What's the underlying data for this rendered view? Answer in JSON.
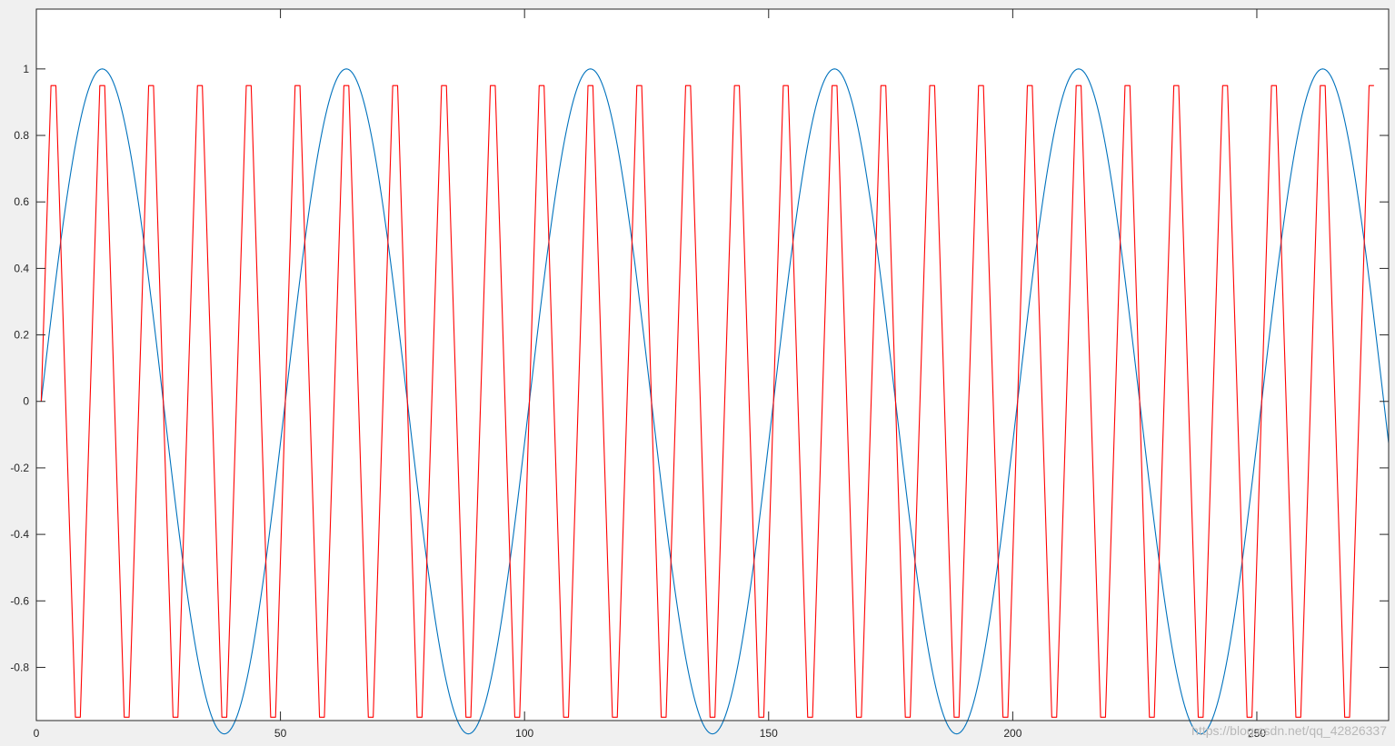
{
  "chart_data": {
    "type": "line",
    "title": "",
    "xlabel": "",
    "ylabel": "",
    "xlim": [
      0,
      277
    ],
    "ylim": [
      -0.96,
      1.18
    ],
    "xticks": [
      0,
      50,
      100,
      150,
      200,
      250
    ],
    "xtick_labels": [
      "0",
      "50",
      "100",
      "150",
      "200",
      "250"
    ],
    "yticks": [
      -0.8,
      -0.6,
      -0.4,
      -0.2,
      0,
      0.2,
      0.4,
      0.6,
      0.8,
      1
    ],
    "ytick_labels": [
      "-0.8",
      "-0.6",
      "-0.4",
      "-0.2",
      "0",
      "0.2",
      "0.4",
      "0.6",
      "0.8",
      "1"
    ],
    "grid": false,
    "legend": "none",
    "colors": {
      "background": "#f0f0f0",
      "axes_bg": "#ffffff",
      "axis": "#262626",
      "tick_text": "#262626"
    },
    "series": [
      {
        "color": "#0072bd",
        "kind": "sine",
        "x_start": 1,
        "x_end": 277,
        "amplitude": 1,
        "period": 50,
        "phase_x": 1
      },
      {
        "color": "#ff0000",
        "kind": "clipped-triangle",
        "x_start": 1,
        "x_end": 277,
        "period": 10,
        "phase_x": 1,
        "peak": 0.95,
        "trough": -0.95,
        "plateau_width": 1
      }
    ]
  },
  "watermark": {
    "text": "https://blog.csdn.net/qq_42826337"
  }
}
